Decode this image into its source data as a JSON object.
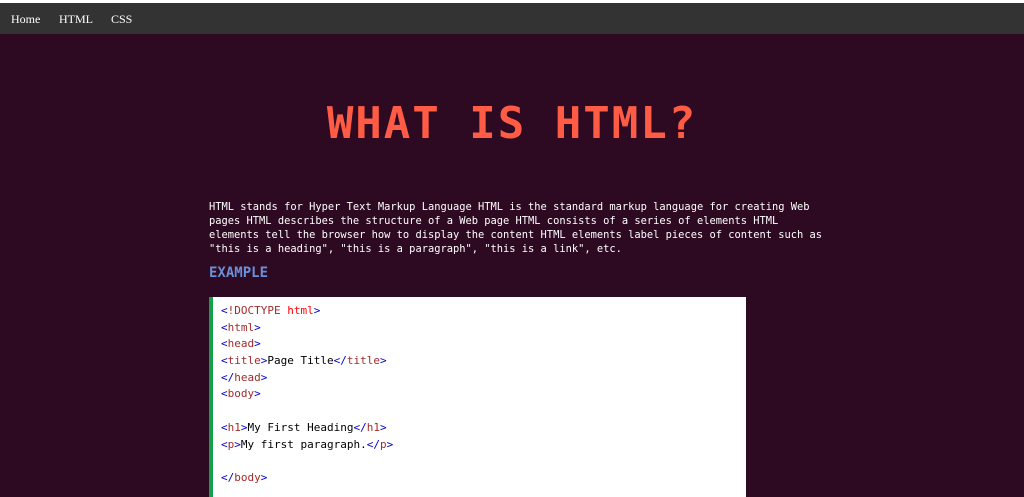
{
  "nav": {
    "items": [
      "Home",
      "HTML",
      "CSS"
    ]
  },
  "main": {
    "title": "WHAT IS HTML?",
    "intro": "HTML stands for Hyper Text Markup Language HTML is the standard markup language for creating Web pages HTML describes the structure of a Web page HTML consists of a series of elements HTML elements tell the browser how to display the content HTML elements label pieces of content such as \"this is a heading\", \"this is a paragraph\", \"this is a link\", etc.",
    "example_heading": "EXAMPLE"
  },
  "code": {
    "doctype_open": "<",
    "doctype_name": "!DOCTYPE",
    "doctype_kw": " html",
    "doctype_close": ">",
    "lines": [
      {
        "open": "html"
      },
      {
        "open": "head"
      },
      {
        "open": "title",
        "text": "Page Title",
        "close": "title"
      },
      {
        "close_only": "head"
      },
      {
        "open": "body"
      },
      {
        "blank": true
      },
      {
        "open": "h1",
        "text": "My First Heading",
        "close": "h1"
      },
      {
        "open": "p",
        "text": "My first paragraph.",
        "close": "p"
      },
      {
        "blank": true
      },
      {
        "close_only": "body"
      }
    ]
  },
  "colors": {
    "background": "#2d0922",
    "navbar": "#333333",
    "title": "#ff5b45",
    "example_heading": "#6a8fd8",
    "code_border": "#14a04a",
    "tag_bracket": "#0000cd",
    "tag_name": "#a52a2a",
    "doctype_keyword": "#ff0000"
  }
}
